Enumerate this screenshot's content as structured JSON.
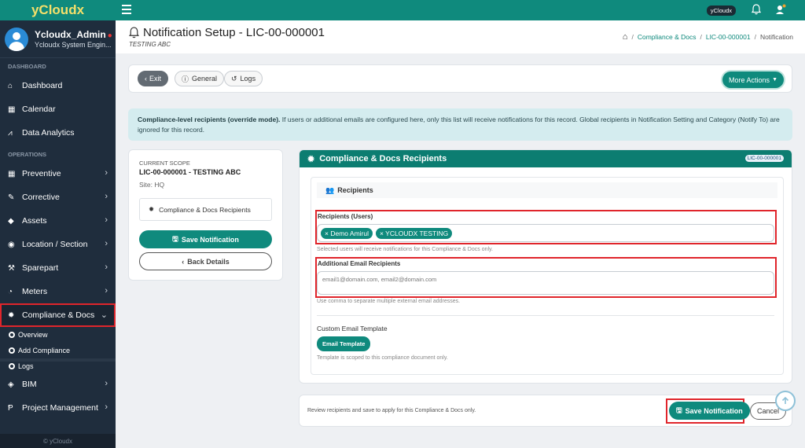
{
  "brand": "yCloudx",
  "topbar": {
    "badge": "yCloudx"
  },
  "user": {
    "name": "Ycloudx_Admin",
    "role": "Ycloudx System Engin..."
  },
  "sidebar": {
    "dashboard_label": "DASHBOARD",
    "operations_label": "OPERATIONS",
    "items": [
      {
        "label": "Dashboard",
        "icon": "home-icon"
      },
      {
        "label": "Calendar",
        "icon": "calendar-icon"
      },
      {
        "label": "Data Analytics",
        "icon": "chart-icon"
      },
      {
        "label": "Preventive",
        "icon": "calendar-icon"
      },
      {
        "label": "Corrective",
        "icon": "wrench-icon"
      },
      {
        "label": "Assets",
        "icon": "tag-icon"
      },
      {
        "label": "Location / Section",
        "icon": "location-icon"
      },
      {
        "label": "Sparepart",
        "icon": "spanner-icon"
      },
      {
        "label": "Meters",
        "icon": "gauge-icon"
      },
      {
        "label": "Compliance & Docs",
        "icon": "gear-icon"
      },
      {
        "label": "BIM",
        "icon": "cube-icon"
      },
      {
        "label": "Project Management",
        "icon": "project-icon"
      }
    ],
    "subitems": [
      "Overview",
      "Add Compliance",
      "Logs"
    ],
    "footer": "© yCloudx"
  },
  "header": {
    "title": "Notification Setup - LIC-00-000001",
    "subtitle": "TESTING ABC",
    "breadcrumb": [
      "Compliance & Docs",
      "LIC-00-000001",
      "Notification"
    ]
  },
  "actions": {
    "exit": "Exit",
    "general": "General",
    "logs": "Logs",
    "more": "More Actions"
  },
  "alert": {
    "bold": "Compliance-level recipients (override mode).",
    "text": " If users or additional emails are configured here, only this list will receive notifications for this record. Global recipients in Notification Setting and Category (Notify To) are ignored for this record."
  },
  "scope": {
    "label": "CURRENT SCOPE",
    "id": "LIC-00-000001 - TESTING ABC",
    "site": "Site: HQ",
    "tab": "Compliance & Docs Recipients",
    "save": "Save Notification",
    "back": "Back Details"
  },
  "recipients": {
    "title": "Compliance & Docs Recipients",
    "tag": "LIC-00-000001",
    "section": "Recipients",
    "users_label": "Recipients (Users)",
    "chips": [
      "Demo Amirul",
      "YCLOUDX TESTING"
    ],
    "users_help": "Selected users will receive notifications for this Compliance & Docs only.",
    "email_label": "Additional Email Recipients",
    "email_placeholder": "email1@domain.com, email2@domain.com",
    "email_help": "Use comma to separate multiple external email addresses.",
    "template_label": "Custom Email Template",
    "template_button": "Email Template",
    "template_help": "Template is scoped to this compliance document only."
  },
  "footer": {
    "note": "Review recipients and save to apply for this Compliance & Docs only.",
    "save": "Save Notification",
    "cancel": "Cancel"
  },
  "colors": {
    "primary": "#0f8a7d",
    "sidebar": "#1f2d3d",
    "highlight": "#e0252b"
  }
}
